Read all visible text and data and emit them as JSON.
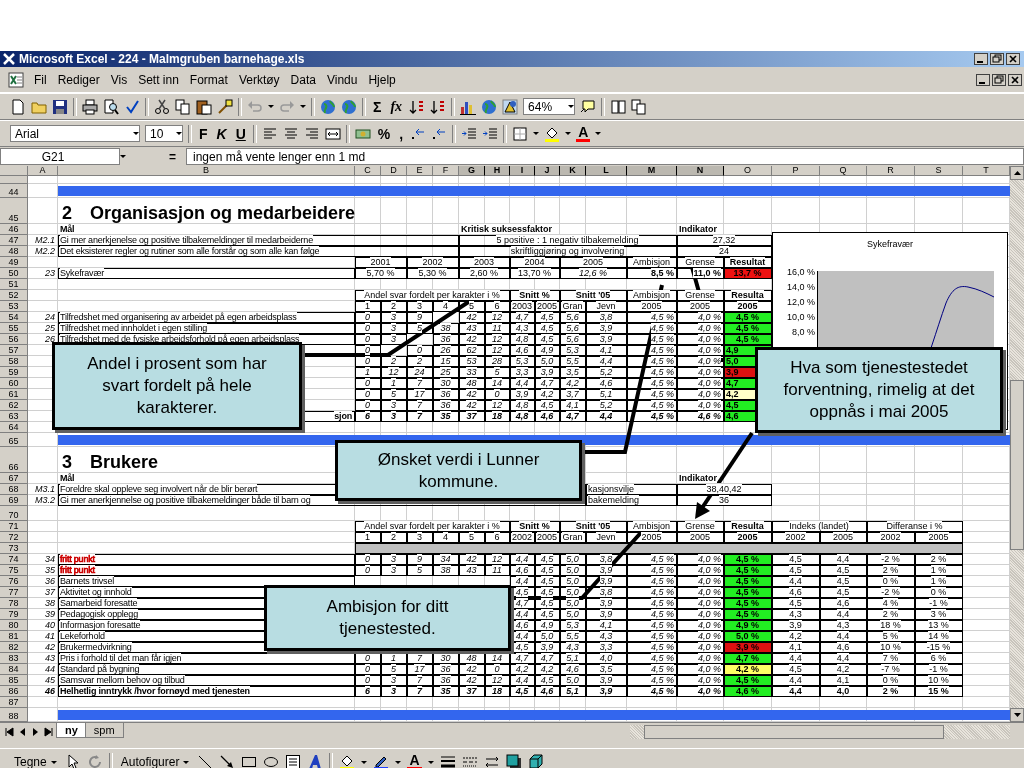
{
  "window": {
    "title": "Microsoft Excel - 224 - Malmgruben barnehage.xls"
  },
  "menu": [
    "Fil",
    "Rediger",
    "Vis",
    "Sett inn",
    "Format",
    "Verktøy",
    "Data",
    "Vindu",
    "Hjelp"
  ],
  "toolbar": {
    "sum": "Σ",
    "function": "fx",
    "zoom": "64%"
  },
  "formatting": {
    "font": "Arial",
    "size": "10",
    "bold": "F",
    "italic": "K",
    "underline": "U",
    "percent": "%",
    "comma": ",",
    "font_color": "A"
  },
  "formula_bar": {
    "cell": "G21",
    "equals": "=",
    "value": "ingen må vente lenger enn 1 md"
  },
  "columns": [
    {
      "letter": "A",
      "selected": false
    },
    {
      "letter": "B",
      "selected": false
    },
    {
      "letter": "C",
      "selected": false
    },
    {
      "letter": "D",
      "selected": false
    },
    {
      "letter": "E",
      "selected": false
    },
    {
      "letter": "F",
      "selected": false
    },
    {
      "letter": "G",
      "selected": true
    },
    {
      "letter": "H",
      "selected": true
    },
    {
      "letter": "I",
      "selected": true
    },
    {
      "letter": "J",
      "selected": true
    },
    {
      "letter": "K",
      "selected": true
    },
    {
      "letter": "L",
      "selected": true
    },
    {
      "letter": "M",
      "selected": true
    },
    {
      "letter": "N",
      "selected": true
    },
    {
      "letter": "O",
      "selected": false
    },
    {
      "letter": "P",
      "selected": false
    },
    {
      "letter": "Q",
      "selected": false
    },
    {
      "letter": "R",
      "selected": false
    },
    {
      "letter": "S",
      "selected": false
    },
    {
      "letter": "T",
      "selected": false
    }
  ],
  "rows": [
    {
      "kind": "cut"
    },
    {
      "n": "44",
      "kind": "band"
    },
    {
      "n": "45",
      "kind": "title",
      "number": "2",
      "title": "Organisasjon og medarbeidere"
    },
    {
      "n": "46",
      "kind": "goal_header",
      "cells": {
        "B": "Mål",
        "G": "Kritisk suksessfaktor",
        "N": "Indikator"
      }
    },
    {
      "n": "47",
      "kind": "goal",
      "cells": {
        "A": "M2.1",
        "B": "Gi mer anerkjenelse og positive tilbakemeldinger til medarbeiderne",
        "G": "5 positive : 1 negativ tilbakemelding",
        "N": "27,32"
      }
    },
    {
      "n": "48",
      "kind": "goal",
      "cells": {
        "A": "M2.2",
        "B": "Det eksisterer regler og rutiner som alle forstår og som alle kan følge",
        "G": "skriftliggjøring og involvering",
        "N": "24"
      }
    },
    {
      "n": "49",
      "kind": "years",
      "cells": {
        "C": "2001",
        "E": "2002",
        "G": "2003",
        "I": "2004",
        "K": "2005",
        "M": "Ambisjon",
        "N": "Grense",
        "O": "Resultat"
      }
    },
    {
      "n": "50",
      "kind": "indicator",
      "cells": {
        "A": "23",
        "B": "Sykefravær",
        "C": "5,70 %",
        "E": "5,30 %",
        "G": "2,60 %",
        "I": "13,70 %",
        "K": "12,6 %",
        "M": "8,5 %",
        "N": "11,0 %",
        "O": {
          "text": "13,7 %",
          "color": "#ee1111"
        }
      }
    },
    {
      "n": "51",
      "kind": "blank"
    },
    {
      "n": "52",
      "kind": "group_header",
      "cells": {
        "C": "Andel svar fordelt per karakter i %",
        "I": "Snitt %",
        "K": "Snitt '05",
        "M": "Ambisjon",
        "N": "Grense",
        "O": "Resulta"
      }
    },
    {
      "n": "53",
      "kind": "subheader",
      "cells": {
        "C": "1",
        "D": "2",
        "E": "3",
        "F": "4",
        "G": "5",
        "H": "6",
        "I": "2003",
        "J": "2005",
        "K": "Gran",
        "L": "Jevn",
        "M": "2005",
        "N": "2005",
        "O": "2005"
      }
    },
    {
      "n": "54",
      "kind": "data",
      "cells": {
        "A": "24",
        "B": "Tilfredshet med organisering av arbeidet på egen arbeidsplass",
        "C": "0",
        "D": "3",
        "E": "9",
        "G": "42",
        "H": "12",
        "I": "4,7",
        "J": "4,5",
        "K": "5,6",
        "L": "3,8",
        "M": "4,5 %",
        "N": "4,0 %",
        "O": {
          "text": "4,5 %",
          "color": "#22ee22"
        }
      }
    },
    {
      "n": "55",
      "kind": "data",
      "cells": {
        "A": "25",
        "B": "Tilfredshet med innholdet i egen stilling",
        "C": "0",
        "D": "3",
        "E": "5",
        "F": "38",
        "G": "43",
        "H": "11",
        "I": "4,3",
        "J": "4,5",
        "K": "5,6",
        "L": "3,9",
        "M": "4,5 %",
        "N": "4,0 %",
        "O": {
          "text": "4,5 %",
          "color": "#22ee22"
        }
      }
    },
    {
      "n": "56",
      "kind": "data",
      "cells": {
        "A": "26",
        "B": "Tilfredshet med de fysiske arbeidsforhold på egen arbeidsplass",
        "C": "0",
        "D": "3",
        "F": "36",
        "G": "42",
        "H": "12",
        "I": "4,8",
        "J": "4,5",
        "K": "5,6",
        "L": "3,9",
        "M": "4,5 %",
        "N": "4,0 %",
        "O": {
          "text": "4,5 %",
          "color": "#22ee22"
        }
      }
    },
    {
      "n": "57",
      "kind": "data",
      "cells": {
        "C": "0",
        "E": "0",
        "F": "26",
        "G": "62",
        "H": "12",
        "I": "4,6",
        "J": "4,9",
        "K": "5,3",
        "L": "4,1",
        "M": "4,5 %",
        "N": "4,0 %",
        "O": {
          "text": "4,9",
          "color": "#22ee22"
        }
      }
    },
    {
      "n": "58",
      "kind": "data",
      "cells": {
        "C": "0",
        "D": "2",
        "E": "2",
        "F": "15",
        "G": "53",
        "H": "28",
        "I": "5,3",
        "J": "5,0",
        "K": "5,5",
        "L": "4,4",
        "M": "4,5 %",
        "N": "4,0 %",
        "O": {
          "text": "5,0",
          "color": "#22ee22"
        }
      }
    },
    {
      "n": "59",
      "kind": "data",
      "cells": {
        "C": "1",
        "D": "12",
        "E": "24",
        "F": "25",
        "G": "33",
        "H": "5",
        "I": "3,3",
        "J": "3,9",
        "K": "3,5",
        "L": "5,2",
        "M": "4,5 %",
        "N": "4,0 %",
        "O": {
          "text": "3,9",
          "color": "#dd1111"
        }
      }
    },
    {
      "n": "60",
      "kind": "data",
      "cells": {
        "C": "0",
        "D": "1",
        "E": "7",
        "F": "30",
        "G": "48",
        "H": "14",
        "I": "4,4",
        "J": "4,7",
        "K": "4,2",
        "L": "4,6",
        "M": "4,5 %",
        "N": "4,0 %",
        "O": {
          "text": "4,7",
          "color": "#22ee22"
        }
      }
    },
    {
      "n": "61",
      "kind": "data",
      "cells": {
        "C": "0",
        "D": "5",
        "E": "17",
        "F": "36",
        "G": "42",
        "H": "0",
        "I": "3,9",
        "J": "4,2",
        "K": "3,7",
        "L": "5,1",
        "M": "4,5 %",
        "N": "4,0 %",
        "O": {
          "text": "4,2",
          "color": "#ffffc8"
        }
      }
    },
    {
      "n": "62",
      "kind": "data",
      "cells": {
        "C": "0",
        "D": "3",
        "E": "7",
        "F": "36",
        "G": "42",
        "H": "12",
        "I": "4,8",
        "J": "4,5",
        "K": "4,1",
        "L": "5,2",
        "M": "4,5 %",
        "N": "4,0 %",
        "O": {
          "text": "4,5",
          "color": "#22ee22"
        }
      }
    },
    {
      "n": "63",
      "kind": "total",
      "cells": {
        "B": "sjon",
        "C": "6",
        "D": "3",
        "E": "7",
        "F": "35",
        "G": "37",
        "H": "18",
        "I": "4,8",
        "J": "4,6",
        "K": "4,7",
        "L": "4,4",
        "M": "4,5 %",
        "N": "4,6 %",
        "O": {
          "text": "4,6",
          "color": "#22ee22"
        }
      }
    },
    {
      "n": "64",
      "kind": "blank"
    },
    {
      "n": "65",
      "kind": "band"
    },
    {
      "n": "66",
      "kind": "title",
      "number": "3",
      "title": "Brukere"
    },
    {
      "n": "67",
      "kind": "goal_header",
      "cells": {
        "B": "Mål",
        "N": "Indikator"
      }
    },
    {
      "n": "68",
      "kind": "goal",
      "cells": {
        "A": "M3.1",
        "B": "Foreldre skal oppleve seg involvert når de blir berørt",
        "L": "kasjonsvilje",
        "N": "38,40,42"
      }
    },
    {
      "n": "69",
      "kind": "goal",
      "cells": {
        "A": "M3.2",
        "B": "Gi mer anerkjennelse og positive tilbakemeldinger både til barn og",
        "L": "bakemelding",
        "N": "36"
      }
    },
    {
      "n": "70",
      "kind": "spacer"
    },
    {
      "n": "71",
      "kind": "group_header",
      "cells": {
        "C": "Andel svar fordelt per karakter i %",
        "I": "Snitt %",
        "K": "Snitt '05",
        "M": "Ambisjon",
        "N": "Grense",
        "O": "Resulta",
        "P": "Indeks (landet)",
        "R": "Differanse i %"
      }
    },
    {
      "n": "72",
      "kind": "subheader",
      "cells": {
        "C": "1",
        "D": "2",
        "E": "3",
        "F": "4",
        "G": "5",
        "H": "6",
        "I": "2002",
        "J": "2005",
        "K": "Gran",
        "L": "Jevn",
        "M": "2005",
        "N": "2005",
        "O": "2005",
        "P": "2002",
        "Q": "2005",
        "R": "2002",
        "S": "2005"
      }
    },
    {
      "n": "73",
      "kind": "shaded"
    },
    {
      "n": "74",
      "kind": "data",
      "cells": {
        "A": "34",
        "B": {
          "text": "fritt punkt",
          "color": "#cc0000"
        },
        "C": "0",
        "D": "3",
        "E": "9",
        "F": "34",
        "G": "42",
        "H": "12",
        "I": "4,4",
        "J": "4,5",
        "K": "5,0",
        "L": "3,8",
        "M": "4,5 %",
        "N": "4,0 %",
        "O": {
          "text": "4,5 %",
          "color": "#22ee22"
        },
        "P": "4,5",
        "Q": "4,4",
        "R": "-2 %",
        "S": "2 %"
      }
    },
    {
      "n": "75",
      "kind": "data",
      "cells": {
        "A": "35",
        "B": {
          "text": "fritt punkt",
          "color": "#cc0000"
        },
        "C": "0",
        "D": "3",
        "E": "5",
        "F": "38",
        "G": "43",
        "H": "11",
        "I": "4,6",
        "J": "4,5",
        "K": "5,0",
        "L": "3,9",
        "M": "4,5 %",
        "N": "4,0 %",
        "O": {
          "text": "4,5 %",
          "color": "#22ee22"
        },
        "P": "4,5",
        "Q": "4,5",
        "R": "2 %",
        "S": "1 %"
      }
    },
    {
      "n": "76",
      "kind": "data",
      "cells": {
        "A": "36",
        "B": "Barnets trivsel",
        "I": "4,4",
        "J": "4,5",
        "K": "5,0",
        "L": "3,9",
        "M": "4,5 %",
        "N": "4,0 %",
        "O": {
          "text": "4,5 %",
          "color": "#22ee22"
        },
        "P": "4,4",
        "Q": "4,5",
        "R": "0 %",
        "S": "1 %"
      }
    },
    {
      "n": "77",
      "kind": "data",
      "cells": {
        "A": "37",
        "B": "Aktivitet og innhold",
        "I": "4,5",
        "J": "4,5",
        "K": "5,0",
        "L": "3,8",
        "M": "4,5 %",
        "N": "4,0 %",
        "O": {
          "text": "4,5 %",
          "color": "#22ee22"
        },
        "P": "4,6",
        "Q": "4,5",
        "R": "-2 %",
        "S": "0 %"
      }
    },
    {
      "n": "78",
      "kind": "data",
      "cells": {
        "A": "38",
        "B": "Samarbeid foresatte",
        "I": "4,7",
        "J": "4,5",
        "K": "5,0",
        "L": "3,9",
        "M": "4,5 %",
        "N": "4,0 %",
        "O": {
          "text": "4,5 %",
          "color": "#22ee22"
        },
        "P": "4,5",
        "Q": "4,6",
        "R": "4 %",
        "S": "-1 %"
      }
    },
    {
      "n": "79",
      "kind": "data",
      "cells": {
        "A": "39",
        "B": "Pedagogisk opplegg",
        "I": "4,4",
        "J": "4,5",
        "K": "5,0",
        "L": "3,9",
        "M": "4,5 %",
        "N": "4,0 %",
        "O": {
          "text": "4,5 %",
          "color": "#22ee22"
        },
        "P": "4,3",
        "Q": "4,4",
        "R": "2 %",
        "S": "3 %"
      }
    },
    {
      "n": "80",
      "kind": "data",
      "cells": {
        "A": "40",
        "B": "Informasjon foresatte",
        "I": "4,6",
        "J": "4,9",
        "K": "5,3",
        "L": "4,1",
        "M": "4,5 %",
        "N": "4,0 %",
        "O": {
          "text": "4,9 %",
          "color": "#22ee22"
        },
        "P": "3,9",
        "Q": "4,3",
        "R": "18 %",
        "S": "13 %"
      }
    },
    {
      "n": "81",
      "kind": "data",
      "cells": {
        "A": "41",
        "B": "Lekeforhold",
        "I": "4,4",
        "J": "5,0",
        "K": "5,5",
        "L": "4,3",
        "M": "4,5 %",
        "N": "4,0 %",
        "O": {
          "text": "5,0 %",
          "color": "#22ee22"
        },
        "P": "4,2",
        "Q": "4,4",
        "R": "5 %",
        "S": "14 %"
      }
    },
    {
      "n": "82",
      "kind": "data",
      "cells": {
        "A": "42",
        "B": "Brukermedvirkning",
        "I": "4,5",
        "J": "3,9",
        "K": "4,3",
        "L": "3,3",
        "M": "4,5 %",
        "N": "4,0 %",
        "O": {
          "text": "3,9 %",
          "color": "#dd1111"
        },
        "P": "4,1",
        "Q": "4,6",
        "R": "10 %",
        "S": "-15 %"
      }
    },
    {
      "n": "83",
      "kind": "data",
      "cells": {
        "A": "43",
        "B": "Pris i forhold til det man får igjen",
        "C": "0",
        "D": "1",
        "E": "7",
        "F": "30",
        "G": "48",
        "H": "14",
        "I": "4,7",
        "J": "4,7",
        "K": "5,1",
        "L": "4,0",
        "M": "4,5 %",
        "N": "4,0 %",
        "O": {
          "text": "4,7 %",
          "color": "#22ee22"
        },
        "P": "4,4",
        "Q": "4,4",
        "R": "7 %",
        "S": "6 %"
      }
    },
    {
      "n": "84",
      "kind": "data",
      "cells": {
        "A": "44",
        "B": "Standard på bygning",
        "C": "0",
        "D": "5",
        "E": "17",
        "F": "36",
        "G": "42",
        "H": "0",
        "I": "4,2",
        "J": "4,2",
        "K": "4,6",
        "L": "3,5",
        "M": "4,5 %",
        "N": "4,0 %",
        "O": {
          "text": "4,2 %",
          "color": "#ffff66"
        },
        "P": "4,5",
        "Q": "4,2",
        "R": "-7 %",
        "S": "-1 %"
      }
    },
    {
      "n": "85",
      "kind": "data",
      "cells": {
        "A": "45",
        "B": "Samsvar mellom behov og tilbud",
        "C": "0",
        "D": "3",
        "E": "7",
        "F": "36",
        "G": "42",
        "H": "12",
        "I": "4,4",
        "J": "4,5",
        "K": "5,0",
        "L": "3,9",
        "M": "4,5 %",
        "N": "4,0 %",
        "O": {
          "text": "4,5 %",
          "color": "#22ee22"
        },
        "P": "4,4",
        "Q": "4,1",
        "R": "0 %",
        "S": "10 %"
      }
    },
    {
      "n": "86",
      "kind": "total",
      "cells": {
        "A": "46",
        "B": "Helhetlig inntrykk /hvor fornøyd med tjenesten",
        "C": "6",
        "D": "3",
        "E": "7",
        "F": "35",
        "G": "37",
        "H": "18",
        "I": "4,5",
        "J": "4,6",
        "K": "5,1",
        "L": "3,9",
        "M": "4,5 %",
        "N": "4,0 %",
        "O": {
          "text": "4,6 %",
          "color": "#22ee22"
        },
        "P": "4,4",
        "Q": "4,0",
        "R": "2 %",
        "S": "15 %"
      }
    },
    {
      "n": "87",
      "kind": "blank"
    },
    {
      "n": "88",
      "kind": "band"
    }
  ],
  "chart": {
    "title": "Sykefravær",
    "y_labels": [
      "16,0 %",
      "14,0 %",
      "12,0 %",
      "10,0 %",
      "8,0 %"
    ]
  },
  "callouts": [
    {
      "text": "Andel i prosent som har svart fordelt på hele karakterer."
    },
    {
      "text": "Hva som tjenestestedet forventning, rimelig at det oppnås i mai 2005"
    },
    {
      "text": "Ønsket verdi i Lunner kommune."
    },
    {
      "text": "Ambisjon for ditt tjenestested."
    }
  ],
  "sheet_tabs": [
    {
      "label": "ny",
      "selected": true
    },
    {
      "label": "spm",
      "selected": false
    }
  ],
  "drawing_toolbar": {
    "draw": "Tegne",
    "autoshapes": "Autofigurer",
    "font_color": "A"
  }
}
